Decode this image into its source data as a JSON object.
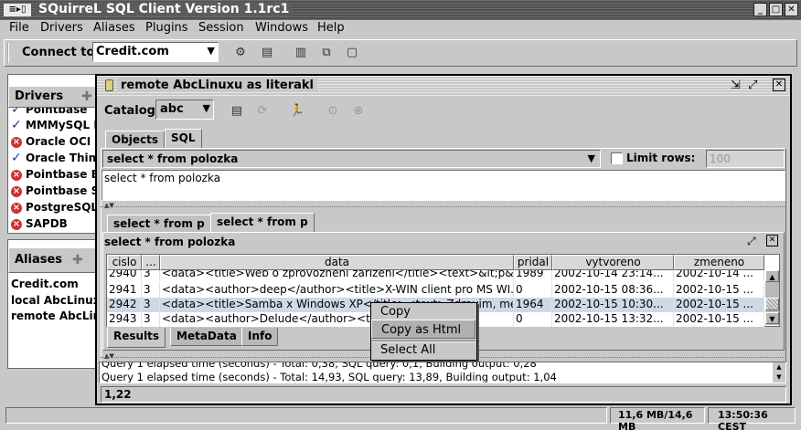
{
  "app": {
    "title": "SQuirreL SQL Client Version 1.1rc1"
  },
  "menu": [
    {
      "label": "File"
    },
    {
      "label": "Drivers"
    },
    {
      "label": "Aliases"
    },
    {
      "label": "Plugins"
    },
    {
      "label": "Session"
    },
    {
      "label": "Windows"
    },
    {
      "label": "Help"
    }
  ],
  "toolbar": {
    "connect_label": "Connect to:",
    "connect_value": "Credit.com"
  },
  "drivers": {
    "title": "Drivers",
    "items": [
      {
        "label": "Pointbase",
        "status": "ok"
      },
      {
        "label": "MMMySQL D",
        "status": "ok"
      },
      {
        "label": "Oracle OCI",
        "status": "error"
      },
      {
        "label": "Oracle Thin",
        "status": "ok"
      },
      {
        "label": "Pointbase E",
        "status": "error"
      },
      {
        "label": "Pointbase S",
        "status": "error"
      },
      {
        "label": "PostgreSQL",
        "status": "error"
      },
      {
        "label": "SAPDB",
        "status": "error"
      }
    ]
  },
  "aliases": {
    "title": "Aliases",
    "items": [
      {
        "label": "Credit.com"
      },
      {
        "label": "local AbcLinux"
      },
      {
        "label": "remote AbcLin"
      }
    ]
  },
  "session": {
    "title": "remote AbcLinuxu as literakl",
    "catalog_label": "Catalog:",
    "catalog_value": "abc",
    "tabs": [
      {
        "label": "Objects"
      },
      {
        "label": "SQL"
      }
    ],
    "sql_history": "select * from polozka",
    "limit_rows_label": "Limit rows:",
    "limit_rows_value": "100",
    "sql_text": "select * from polozka",
    "result_tabs": [
      {
        "label": "select * from p"
      },
      {
        "label": "select * from p"
      }
    ],
    "result_title": "select * from polozka",
    "columns": [
      "cislo",
      "...",
      "data",
      "pridal",
      "vytvoreno",
      "zmeneno"
    ],
    "rows": [
      {
        "cislo": "2940",
        "typ": "3",
        "data": "<data><title>Web o zprovozneni zarizeni</title><text>&lt;p&...",
        "pridal": "1989",
        "vytvoreno": "2002-10-14 23:14...",
        "zmeneno": "2002-10-14 ..."
      },
      {
        "cislo": "2941",
        "typ": "3",
        "data": "<data><author>deep</author><title>X-WIN client pro MS WI...",
        "pridal": "0",
        "vytvoreno": "2002-10-15 08:36...",
        "zmeneno": "2002-10-15 ..."
      },
      {
        "cislo": "2942",
        "typ": "3",
        "data": "<data><title>Samba x Windows XP</title><text>Zdravim, me...",
        "pridal": "1964",
        "vytvoreno": "2002-10-15 10:30...",
        "zmeneno": "2002-10-15 ..."
      },
      {
        "cislo": "2943",
        "typ": "3",
        "data": "<data><author>Delude</author><title>Windows...",
        "pridal": "0",
        "vytvoreno": "2002-10-15 13:32...",
        "zmeneno": "2002-10-15 ..."
      }
    ],
    "bottom_tabs": [
      {
        "label": "Results"
      },
      {
        "label": "MetaData"
      },
      {
        "label": "Info"
      }
    ],
    "log": [
      "Query 1 elapsed time (seconds) - Total: 0,38, SQL query: 0,1, Building output: 0,28",
      "Query 1 elapsed time (seconds) - Total: 14,93, SQL query: 13,89, Building output: 1,04"
    ],
    "position": "1,22"
  },
  "context_menu": {
    "items": [
      {
        "label": "Copy"
      },
      {
        "label": "Copy as Html"
      },
      {
        "label": "Select All"
      }
    ]
  },
  "status": {
    "memory": "11,6 MB/14,6 MB",
    "time": "13:50:36 CEST"
  }
}
